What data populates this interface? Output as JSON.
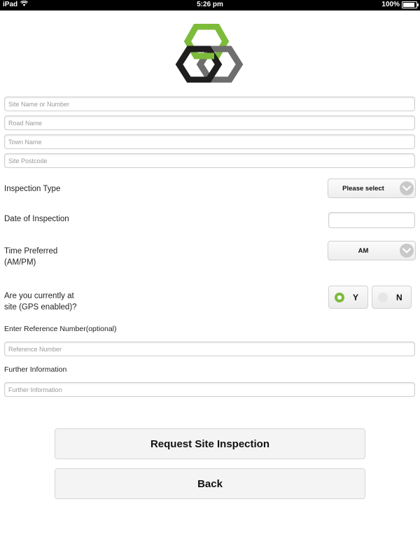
{
  "status_bar": {
    "device": "iPad",
    "time": "5:26 pm",
    "battery_percent": "100%",
    "battery_level": 1.0,
    "wifi_icon": "wifi-icon"
  },
  "logo": {
    "icon": "interlocking-hexagons-logo",
    "colors": {
      "green": "#7dbb3b",
      "black": "#1e1e1e",
      "gray": "#6e6e6e"
    }
  },
  "form": {
    "site_name": {
      "placeholder": "Site Name or Number",
      "value": ""
    },
    "road_name": {
      "placeholder": "Road Name",
      "value": ""
    },
    "town_name": {
      "placeholder": "Town Name",
      "value": ""
    },
    "site_postcode": {
      "placeholder": "Site Postcode",
      "value": ""
    },
    "inspection_type": {
      "label": "Inspection Type",
      "selected": "Please select"
    },
    "date_of_inspection": {
      "label": "Date of Inspection",
      "value": ""
    },
    "time_preferred": {
      "label_line1": "Time Preferred",
      "label_line2": "(AM/PM)",
      "selected": "AM"
    },
    "at_site": {
      "label_line1": "Are you currently at",
      "label_line2": "site (GPS enabled)?",
      "options": [
        "Y",
        "N"
      ],
      "selected": "Y"
    },
    "reference_number": {
      "label": "Enter Reference Number(optional)",
      "placeholder": "Reference Number",
      "value": ""
    },
    "further_information": {
      "label": "Further Information",
      "placeholder": "Further Information",
      "value": ""
    }
  },
  "buttons": {
    "request": "Request Site Inspection",
    "back": "Back"
  },
  "accent_color": "#7dbb3b"
}
